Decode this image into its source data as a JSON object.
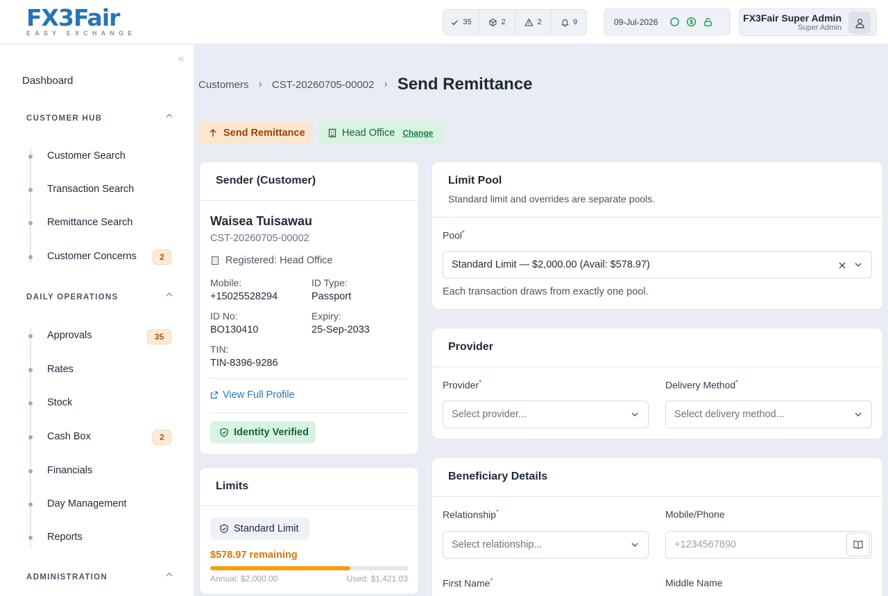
{
  "header": {
    "logo_main": "FX3Fair",
    "logo_sub": "EASY EXCHANGE",
    "counters": [
      {
        "icon": "check-icon",
        "value": "35"
      },
      {
        "icon": "box-icon",
        "value": "2"
      },
      {
        "icon": "warning-icon",
        "value": "2"
      },
      {
        "icon": "bell-icon",
        "value": "9"
      }
    ],
    "date": "09-Jul-2026",
    "user_name": "FX3Fair Super Admin",
    "user_role": "Super Admin"
  },
  "sidebar": {
    "dashboard": "Dashboard",
    "sections": [
      {
        "title": "CUSTOMER HUB",
        "items": [
          {
            "label": "Customer Search"
          },
          {
            "label": "Transaction Search"
          },
          {
            "label": "Remittance Search"
          },
          {
            "label": "Customer Concerns",
            "badge": "2"
          }
        ]
      },
      {
        "title": "DAILY OPERATIONS",
        "items": [
          {
            "label": "Approvals",
            "badge": "35"
          },
          {
            "label": "Rates"
          },
          {
            "label": "Stock"
          },
          {
            "label": "Cash Box",
            "badge": "2"
          },
          {
            "label": "Financials"
          },
          {
            "label": "Day Management"
          },
          {
            "label": "Reports"
          }
        ]
      },
      {
        "title": "ADMINISTRATION",
        "items": []
      }
    ]
  },
  "breadcrumb": {
    "root": "Customers",
    "customer": "CST-20260705-00002",
    "title": "Send Remittance"
  },
  "pills": {
    "send": "Send Remittance",
    "office": "Head Office",
    "change": "Change"
  },
  "sender": {
    "title": "Sender (Customer)",
    "name": "Waisea Tuisawau",
    "id": "CST-20260705-00002",
    "registered": "Registered: Head Office",
    "mobile_label": "Mobile:",
    "mobile": "+15025528294",
    "idtype_label": "ID Type:",
    "idtype": "Passport",
    "idno_label": "ID No:",
    "idno": "BO130410",
    "expiry_label": "Expiry:",
    "expiry": "25-Sep-2033",
    "tin_label": "TIN:",
    "tin": "TIN-8396-9286",
    "view_profile": "View Full Profile",
    "verified": "Identity Verified"
  },
  "limits": {
    "title": "Limits",
    "badge": "Standard Limit",
    "remaining": "$578.97 remaining",
    "annual": "Annual: $2,000.00",
    "used": "Used: $1,421.03",
    "used_fraction": 0.7105
  },
  "limit_pool": {
    "title": "Limit Pool",
    "subtitle": "Standard limit and overrides are separate pools.",
    "pool_label": "Pool",
    "pool_value": "Standard Limit — $2,000.00 (Avail: $578.97)",
    "help": "Each transaction draws from exactly one pool."
  },
  "provider": {
    "title": "Provider",
    "provider_label": "Provider",
    "provider_placeholder": "Select provider...",
    "delivery_label": "Delivery Method",
    "delivery_placeholder": "Select delivery method..."
  },
  "beneficiary": {
    "title": "Beneficiary Details",
    "relationship_label": "Relationship",
    "relationship_placeholder": "Select relationship...",
    "mobile_label": "Mobile/Phone",
    "mobile_placeholder": "+1234567890",
    "first_name_label": "First Name",
    "middle_name_label": "Middle Name"
  },
  "colors": {
    "brand": "#2574b8",
    "progress": "#f59e0b",
    "success": "#166534",
    "warning": "#b45309"
  }
}
